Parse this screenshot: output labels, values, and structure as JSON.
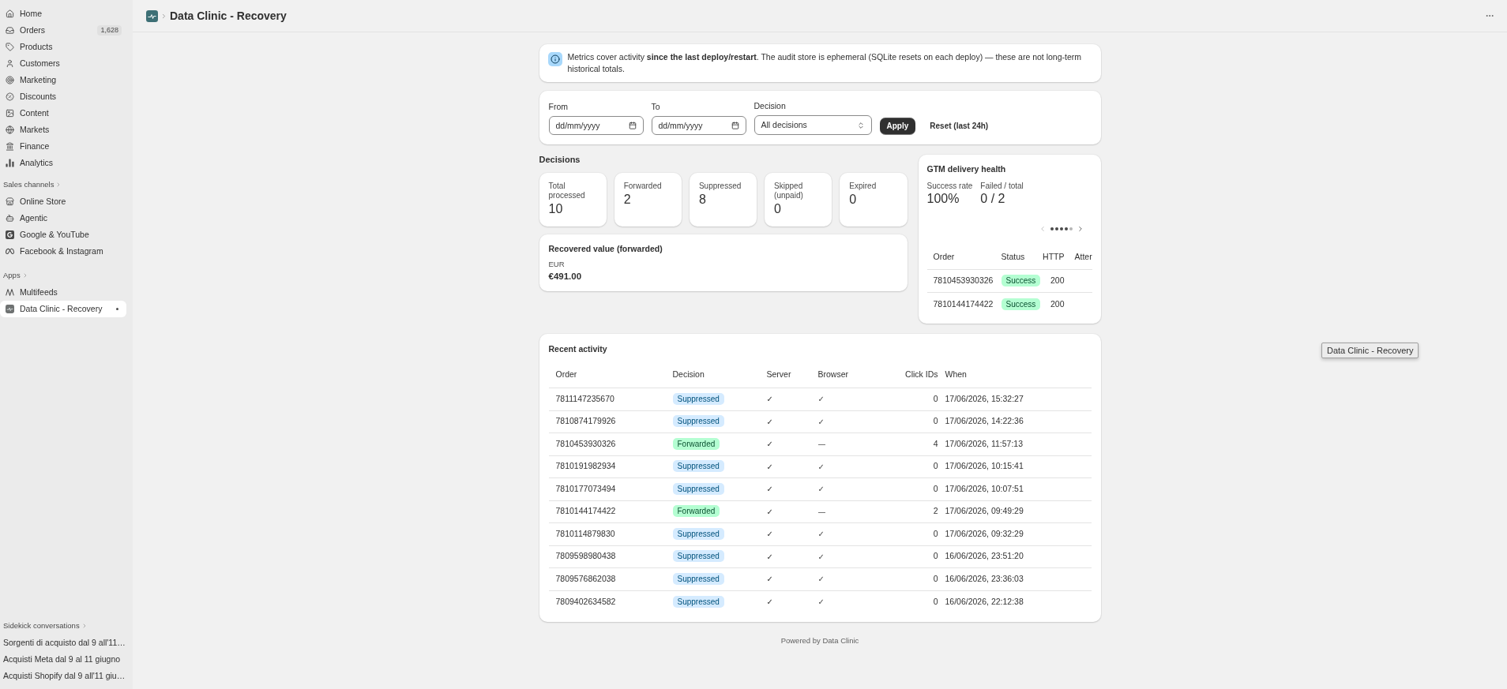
{
  "sidebar": {
    "nav_items": [
      {
        "label": "Home",
        "selected": false
      },
      {
        "label": "Orders",
        "selected": false,
        "count": "1,628"
      },
      {
        "label": "Products",
        "selected": false
      },
      {
        "label": "Customers",
        "selected": false
      },
      {
        "label": "Marketing",
        "selected": false
      },
      {
        "label": "Discounts",
        "selected": false
      },
      {
        "label": "Content",
        "selected": false
      },
      {
        "label": "Markets",
        "selected": false
      },
      {
        "label": "Finance",
        "selected": false
      },
      {
        "label": "Analytics",
        "selected": false
      }
    ],
    "sales_channels": {
      "heading": "Sales channels",
      "items": [
        {
          "label": "Online Store",
          "selected": false
        },
        {
          "label": "Agentic",
          "selected": false
        },
        {
          "label": "Google & YouTube",
          "selected": false
        },
        {
          "label": "Facebook & Instagram",
          "selected": false
        }
      ]
    },
    "apps": {
      "heading": "Apps",
      "items": [
        {
          "label": "Multifeeds",
          "selected": false
        },
        {
          "label": "Data Clinic - Recovery",
          "selected": true
        }
      ]
    },
    "sidekick": {
      "heading": "Sidekick conversations",
      "items": [
        "Sorgenti di acquisto dal 9 all'11…",
        "Acquisti Meta dal 9 al 11 giugno",
        "Acquisti Shopify dal 9 all'11 giu…"
      ]
    }
  },
  "header": {
    "title": "Data Clinic - Recovery"
  },
  "notice": {
    "text": "Metrics cover activity **since the last deploy/restart**. The audit store is ephemeral (SQLite resets on each deploy) — these are not long-term historical totals."
  },
  "filters": {
    "from": {
      "label": "From",
      "placeholder": "dd/mm/yyyy"
    },
    "to": {
      "label": "To",
      "placeholder": "dd/mm/yyyy"
    },
    "decision": {
      "label": "Decision",
      "value": "All decisions"
    },
    "apply": "Apply",
    "reset": "Reset (last 24h)"
  },
  "decisions": {
    "heading": "Decisions",
    "stats": [
      {
        "label": "Total processed",
        "value": "10"
      },
      {
        "label": "Forwarded",
        "value": "2"
      },
      {
        "label": "Suppressed",
        "value": "8"
      },
      {
        "label": "Skipped (unpaid)",
        "value": "0"
      },
      {
        "label": "Expired",
        "value": "0"
      }
    ],
    "recovered": {
      "title": "Recovered value (forwarded)",
      "currency": "EUR",
      "amount": "€491.00"
    }
  },
  "gtm": {
    "title": "GTM delivery health",
    "metrics": [
      {
        "label": "Success rate",
        "value": "100%"
      },
      {
        "label": "Failed / total",
        "value": "0 / 2"
      }
    ],
    "pager": {
      "prev": {
        "disabled": true
      },
      "next": {
        "disabled": false
      },
      "pips": [
        {
          "visible": true
        },
        {
          "visible": true
        },
        {
          "visible": true
        },
        {
          "visible": true
        },
        {
          "visible": false
        }
      ]
    },
    "columns": [
      "Order",
      "Status",
      "HTTP",
      "Atter"
    ],
    "rows": [
      {
        "order": "7810453930326",
        "status": "Success",
        "kind": "success",
        "http": "200"
      },
      {
        "order": "7810144174422",
        "status": "Success",
        "kind": "success",
        "http": "200"
      }
    ]
  },
  "activity": {
    "title": "Recent activity",
    "columns": [
      "Order",
      "Decision",
      "Server",
      "Browser",
      "Click IDs",
      "When"
    ],
    "rows": [
      {
        "order": "7811147235670",
        "decision": "Suppressed",
        "kind": "info",
        "server": "✓",
        "browser": "✓",
        "click_ids": "0",
        "when": "17/06/2026, 15:32:27"
      },
      {
        "order": "7810874179926",
        "decision": "Suppressed",
        "kind": "info",
        "server": "✓",
        "browser": "✓",
        "click_ids": "0",
        "when": "17/06/2026, 14:22:36"
      },
      {
        "order": "7810453930326",
        "decision": "Forwarded",
        "kind": "success",
        "server": "✓",
        "browser": "—",
        "click_ids": "4",
        "when": "17/06/2026, 11:57:13"
      },
      {
        "order": "7810191982934",
        "decision": "Suppressed",
        "kind": "info",
        "server": "✓",
        "browser": "✓",
        "click_ids": "0",
        "when": "17/06/2026, 10:15:41"
      },
      {
        "order": "7810177073494",
        "decision": "Suppressed",
        "kind": "info",
        "server": "✓",
        "browser": "✓",
        "click_ids": "0",
        "when": "17/06/2026, 10:07:51"
      },
      {
        "order": "7810144174422",
        "decision": "Forwarded",
        "kind": "success",
        "server": "✓",
        "browser": "—",
        "click_ids": "2",
        "when": "17/06/2026, 09:49:29"
      },
      {
        "order": "7810114879830",
        "decision": "Suppressed",
        "kind": "info",
        "server": "✓",
        "browser": "✓",
        "click_ids": "0",
        "when": "17/06/2026, 09:32:29"
      },
      {
        "order": "7809598980438",
        "decision": "Suppressed",
        "kind": "info",
        "server": "✓",
        "browser": "✓",
        "click_ids": "0",
        "when": "16/06/2026, 23:51:20"
      },
      {
        "order": "7809576862038",
        "decision": "Suppressed",
        "kind": "info",
        "server": "✓",
        "browser": "✓",
        "click_ids": "0",
        "when": "16/06/2026, 23:36:03"
      },
      {
        "order": "7809402634582",
        "decision": "Suppressed",
        "kind": "info",
        "server": "✓",
        "browser": "✓",
        "click_ids": "0",
        "when": "16/06/2026, 22:12:38"
      }
    ]
  },
  "footer": "Powered by Data Clinic",
  "tooltip": "Data Clinic - Recovery"
}
